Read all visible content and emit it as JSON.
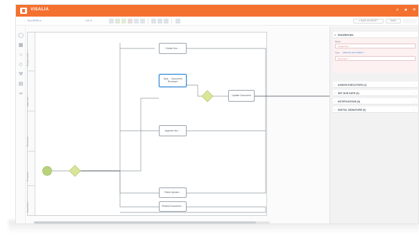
{
  "app": {
    "brand": "VISALIA",
    "accent_color": "#f4702f",
    "topbar_icons": [
      "search-icon",
      "user-icon",
      "menu-icon"
    ]
  },
  "toolbar": {
    "breadcrumb": "← Test BPMN ▾",
    "zoom_text": "100 %",
    "save_draft_label": "▾ SAVE AS DRAFT",
    "save_label": "SAVE"
  },
  "left_tools": [
    "hand-icon",
    "grid-icon",
    "circle-icon",
    "diamond-icon",
    "wrench-icon",
    "clipboard-icon",
    "link-icon"
  ],
  "diagram": {
    "lanes": [
      "Responsible ...",
      "Approver ...",
      "Reviewer ...",
      "Process ...",
      "Assistant ..."
    ],
    "tasks": [
      {
        "label": "Create Doc ..."
      },
      {
        "label": "Task ... Document Reviewer"
      },
      {
        "label": "Update Document"
      },
      {
        "label": "Approve doc ..."
      },
      {
        "label": "Finish Upload ..."
      },
      {
        "label": "Review Document ..."
      }
    ]
  },
  "properties": {
    "sections": [
      {
        "title": "PROPERTIES",
        "expanded": true
      },
      {
        "title": "ASSIGN EXECUTORS (1)",
        "expanded": false
      },
      {
        "title": "SET DUE DATE (0)",
        "expanded": false
      },
      {
        "title": "NOTIFICATIONS (0)",
        "expanded": false
      },
      {
        "title": "DIGITAL SIGNATURE (0)",
        "expanded": false
      }
    ],
    "name_label": "Name",
    "name_value": "Create Doc ...",
    "type_label": "Type",
    "type_link": "CREATE DOCUMENT ...",
    "field_value": "Document ..."
  }
}
